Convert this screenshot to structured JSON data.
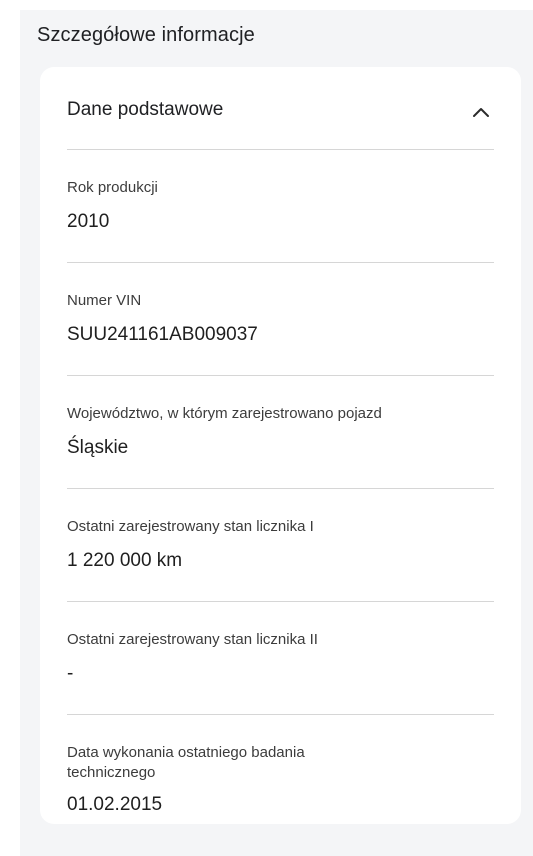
{
  "section": {
    "title": "Szczegółowe informacje"
  },
  "card": {
    "title": "Dane podstawowe",
    "collapse_icon": "chevron-up-icon",
    "fields": [
      {
        "label": "Rok produkcji",
        "value": "2010"
      },
      {
        "label": "Numer VIN",
        "value": "SUU241161AB009037"
      },
      {
        "label": "Województwo, w którym zarejestrowano pojazd",
        "value": "Śląskie"
      },
      {
        "label": "Ostatni zarejestrowany stan licznika I",
        "value": "1 220 000 km"
      },
      {
        "label": "Ostatni zarejestrowany stan licznika II",
        "value": "-"
      },
      {
        "label": "Data wykonania ostatniego badania technicznego",
        "value": "01.02.2015"
      }
    ]
  }
}
